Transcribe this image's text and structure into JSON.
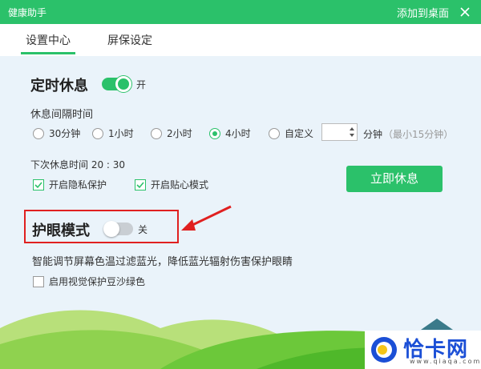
{
  "window": {
    "title": "健康助手",
    "pin_to_desktop": "添加到桌面",
    "close_icon": "close-icon"
  },
  "tabs": [
    {
      "label": "设置中心",
      "active": true
    },
    {
      "label": "屏保设定",
      "active": false
    }
  ],
  "scheduled_rest": {
    "title": "定时休息",
    "enabled": true,
    "state_label": "开",
    "interval_label": "休息间隔时间",
    "options": [
      {
        "label": "30分钟",
        "checked": false
      },
      {
        "label": "1小时",
        "checked": false
      },
      {
        "label": "2小时",
        "checked": false
      },
      {
        "label": "4小时",
        "checked": true
      },
      {
        "label": "自定义",
        "checked": false
      }
    ],
    "custom_value": "",
    "unit_label": "分钟",
    "min_hint": "（最小15分钟）",
    "next_rest": "下次休息时间 20 : 30",
    "privacy": {
      "label": "开启隐私保护",
      "checked": true
    },
    "caring": {
      "label": "开启贴心模式",
      "checked": true
    },
    "rest_now_button": "立即休息"
  },
  "eye_mode": {
    "title": "护眼模式",
    "enabled": false,
    "state_label": "关",
    "description": "智能调节屏幕色温过滤蓝光，降低蓝光辐射伤害保护眼睛",
    "green_bean": {
      "label": "启用视觉保护豆沙绿色",
      "checked": false
    }
  },
  "watermark": {
    "name": "恰卡网",
    "url": "www.qiaqa.com"
  },
  "colors": {
    "accent": "#2bc16a",
    "highlight": "#e02020",
    "background": "#eaf3fa"
  }
}
